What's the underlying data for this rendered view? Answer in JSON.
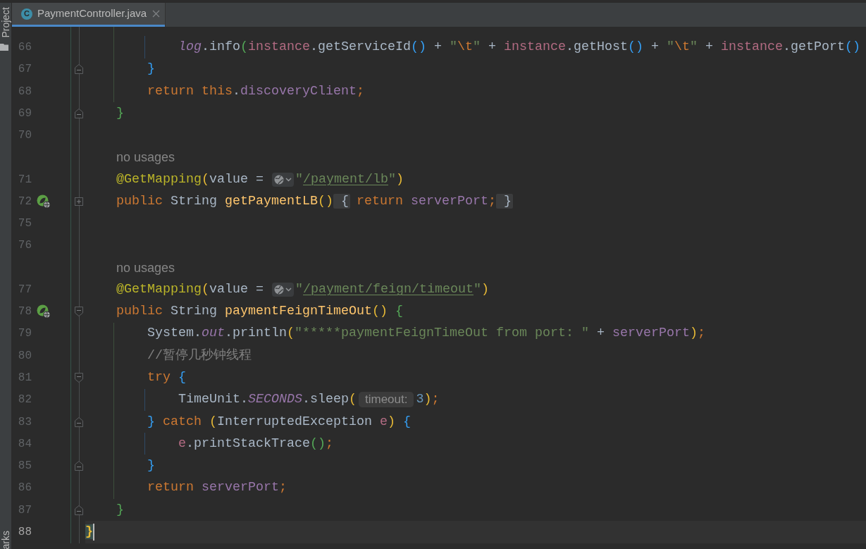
{
  "tool_strip": {
    "top": [
      {
        "label": "Project"
      }
    ],
    "bottom": [
      {
        "label": "arks"
      }
    ]
  },
  "tabs": [
    {
      "icon_text": "C",
      "title": "PaymentController.java",
      "selected": true
    }
  ],
  "editor": {
    "lines": [
      {
        "kind": "code",
        "number": "66",
        "current": false,
        "endpoint": false,
        "tokens": [
          {
            "kind": "static",
            "text": "            log"
          },
          {
            "kind": "plain",
            "text": ".info"
          },
          {
            "kind": "bracket",
            "text": "(",
            "color": "#54a857"
          },
          {
            "kind": "local",
            "text": "instance"
          },
          {
            "kind": "plain",
            "text": ".getServiceId"
          },
          {
            "kind": "bracket",
            "text": "()",
            "color": "#359ff4"
          },
          {
            "kind": "plain",
            "text": " + "
          },
          {
            "kind": "string",
            "text": "\""
          },
          {
            "kind": "escape",
            "text": "\\t"
          },
          {
            "kind": "string",
            "text": "\""
          },
          {
            "kind": "plain",
            "text": " + "
          },
          {
            "kind": "local",
            "text": "instance"
          },
          {
            "kind": "plain",
            "text": ".getHost"
          },
          {
            "kind": "bracket",
            "text": "()",
            "color": "#359ff4"
          },
          {
            "kind": "plain",
            "text": " + "
          },
          {
            "kind": "string",
            "text": "\""
          },
          {
            "kind": "escape",
            "text": "\\t"
          },
          {
            "kind": "string",
            "text": "\""
          },
          {
            "kind": "plain",
            "text": " + "
          },
          {
            "kind": "local",
            "text": "instance"
          },
          {
            "kind": "plain",
            "text": ".getPort"
          },
          {
            "kind": "bracket",
            "text": "()",
            "color": "#359ff4"
          }
        ]
      },
      {
        "kind": "code",
        "number": "67",
        "current": false,
        "endpoint": false,
        "fold": {
          "kind": "end"
        },
        "tokens": [
          {
            "kind": "bracket",
            "text": "        }",
            "color": "#359ff4"
          }
        ]
      },
      {
        "kind": "code",
        "number": "68",
        "current": false,
        "endpoint": false,
        "tokens": [
          {
            "kind": "keyword",
            "text": "        return "
          },
          {
            "kind": "keyword",
            "text": "this"
          },
          {
            "kind": "plain",
            "text": "."
          },
          {
            "kind": "field",
            "text": "discoveryClient"
          },
          {
            "kind": "keyword",
            "text": ";"
          }
        ]
      },
      {
        "kind": "code",
        "number": "69",
        "current": false,
        "endpoint": false,
        "fold": {
          "kind": "end"
        },
        "tokens": [
          {
            "kind": "bracket",
            "text": "    }",
            "color": "#54a857"
          }
        ]
      },
      {
        "kind": "code",
        "number": "70",
        "current": false,
        "endpoint": false
      },
      {
        "kind": "hint",
        "text": "no usages"
      },
      {
        "kind": "code",
        "number": "71",
        "current": false,
        "endpoint": false,
        "tokens": [
          {
            "kind": "annotation",
            "text": "    @GetMapping"
          },
          {
            "kind": "bracket",
            "text": "(",
            "color": "#e8ba36"
          },
          {
            "kind": "plain",
            "text": "value = "
          },
          {
            "kind": "globe"
          },
          {
            "kind": "string",
            "text": "\""
          },
          {
            "kind": "url",
            "text": "/payment/lb"
          },
          {
            "kind": "string",
            "text": "\""
          },
          {
            "kind": "bracket",
            "text": ")",
            "color": "#e8ba36"
          }
        ]
      },
      {
        "kind": "code",
        "number": "72",
        "current": false,
        "endpoint": true,
        "fold": {
          "kind": "collapsed"
        },
        "tokens": [
          {
            "kind": "keyword",
            "text": "    public"
          },
          {
            "kind": "plain",
            "text": " String "
          },
          {
            "kind": "method",
            "text": "getPaymentLB"
          },
          {
            "kind": "bracket",
            "text": "()",
            "color": "#e8ba36"
          },
          {
            "kind": "foldbrace",
            "text": " {"
          },
          {
            "kind": "keyword",
            "text": " return "
          },
          {
            "kind": "field",
            "text": "serverPort"
          },
          {
            "kind": "keyword",
            "text": ";"
          },
          {
            "kind": "foldbrace",
            "text": " }"
          }
        ]
      },
      {
        "kind": "code",
        "number": "75",
        "current": false,
        "endpoint": false
      },
      {
        "kind": "code",
        "number": "76",
        "current": false,
        "endpoint": false
      },
      {
        "kind": "hint",
        "text": "no usages"
      },
      {
        "kind": "code",
        "number": "77",
        "current": false,
        "endpoint": false,
        "tokens": [
          {
            "kind": "annotation",
            "text": "    @GetMapping"
          },
          {
            "kind": "bracket",
            "text": "(",
            "color": "#e8ba36"
          },
          {
            "kind": "plain",
            "text": "value = "
          },
          {
            "kind": "globe"
          },
          {
            "kind": "string",
            "text": "\""
          },
          {
            "kind": "url",
            "text": "/payment/feign/timeout"
          },
          {
            "kind": "string",
            "text": "\""
          },
          {
            "kind": "bracket",
            "text": ")",
            "color": "#e8ba36"
          }
        ]
      },
      {
        "kind": "code",
        "number": "78",
        "current": false,
        "endpoint": true,
        "fold": {
          "kind": "start"
        },
        "tokens": [
          {
            "kind": "keyword",
            "text": "    public"
          },
          {
            "kind": "plain",
            "text": " String "
          },
          {
            "kind": "method",
            "text": "paymentFeignTimeOut"
          },
          {
            "kind": "bracket",
            "text": "()",
            "color": "#e8ba36"
          },
          {
            "kind": "bracket",
            "text": " {",
            "color": "#54a857"
          }
        ]
      },
      {
        "kind": "code",
        "number": "79",
        "current": false,
        "endpoint": false,
        "tokens": [
          {
            "kind": "plain",
            "text": "        System."
          },
          {
            "kind": "static",
            "text": "out"
          },
          {
            "kind": "plain",
            "text": ".println"
          },
          {
            "kind": "bracket",
            "text": "(",
            "color": "#e8ba36"
          },
          {
            "kind": "string",
            "text": "\"*****paymentFeignTimeOut from port: \""
          },
          {
            "kind": "plain",
            "text": " + "
          },
          {
            "kind": "field",
            "text": "serverPort"
          },
          {
            "kind": "bracket",
            "text": ")",
            "color": "#e8ba36"
          },
          {
            "kind": "keyword",
            "text": ";"
          }
        ]
      },
      {
        "kind": "code",
        "number": "80",
        "current": false,
        "endpoint": false,
        "tokens": [
          {
            "kind": "comment",
            "text": "        //暂停几秒钟线程"
          }
        ]
      },
      {
        "kind": "code",
        "number": "81",
        "current": false,
        "endpoint": false,
        "fold": {
          "kind": "start"
        },
        "tokens": [
          {
            "kind": "keyword",
            "text": "        try "
          },
          {
            "kind": "bracket",
            "text": "{",
            "color": "#359ff4"
          }
        ]
      },
      {
        "kind": "code",
        "number": "82",
        "current": false,
        "endpoint": false,
        "tokens": [
          {
            "kind": "plain",
            "text": "            TimeUnit."
          },
          {
            "kind": "static",
            "text": "SECONDS"
          },
          {
            "kind": "plain",
            "text": ".sleep"
          },
          {
            "kind": "bracket",
            "text": "(",
            "color": "#e8ba36"
          },
          {
            "kind": "inlay",
            "text": "timeout:"
          },
          {
            "kind": "number",
            "text": "3"
          },
          {
            "kind": "bracket",
            "text": ")",
            "color": "#e8ba36"
          },
          {
            "kind": "keyword",
            "text": ";"
          }
        ]
      },
      {
        "kind": "code",
        "number": "83",
        "current": false,
        "endpoint": false,
        "fold": {
          "kind": "end"
        },
        "tokens": [
          {
            "kind": "bracket",
            "text": "        }",
            "color": "#359ff4"
          },
          {
            "kind": "keyword",
            "text": " catch "
          },
          {
            "kind": "bracket",
            "text": "(",
            "color": "#e8ba36"
          },
          {
            "kind": "plain",
            "text": "InterruptedException "
          },
          {
            "kind": "local",
            "text": "e"
          },
          {
            "kind": "bracket",
            "text": ")",
            "color": "#e8ba36"
          },
          {
            "kind": "bracket",
            "text": " {",
            "color": "#359ff4"
          }
        ]
      },
      {
        "kind": "code",
        "number": "84",
        "current": false,
        "endpoint": false,
        "tokens": [
          {
            "kind": "local",
            "text": "            e"
          },
          {
            "kind": "plain",
            "text": ".printStackTrace"
          },
          {
            "kind": "bracket",
            "text": "()",
            "color": "#54a857"
          },
          {
            "kind": "keyword",
            "text": ";"
          }
        ]
      },
      {
        "kind": "code",
        "number": "85",
        "current": false,
        "endpoint": false,
        "fold": {
          "kind": "end"
        },
        "tokens": [
          {
            "kind": "bracket",
            "text": "        }",
            "color": "#359ff4"
          }
        ]
      },
      {
        "kind": "code",
        "number": "86",
        "current": false,
        "endpoint": false,
        "tokens": [
          {
            "kind": "keyword",
            "text": "        return "
          },
          {
            "kind": "field",
            "text": "serverPort"
          },
          {
            "kind": "keyword",
            "text": ";"
          }
        ]
      },
      {
        "kind": "code",
        "number": "87",
        "current": false,
        "endpoint": false,
        "fold": {
          "kind": "end"
        },
        "tokens": [
          {
            "kind": "bracket",
            "text": "    }",
            "color": "#54a857"
          }
        ]
      },
      {
        "kind": "code",
        "number": "88",
        "current": true,
        "endpoint": false,
        "tokens": [
          {
            "kind": "matched",
            "text": "}"
          }
        ]
      }
    ]
  }
}
